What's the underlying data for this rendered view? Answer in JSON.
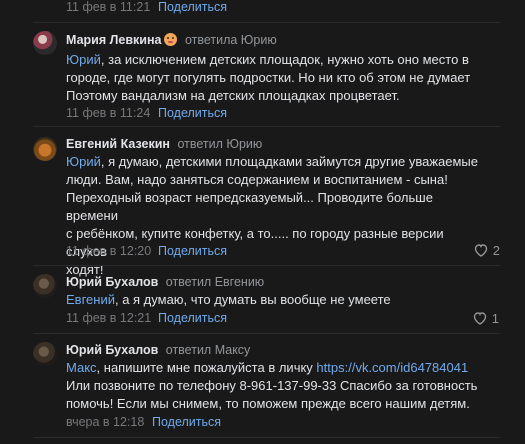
{
  "top_row": {
    "time": "11 фев в 11:21",
    "share": "Поделиться"
  },
  "comments": [
    {
      "author": "Мария Левкина",
      "replied": "ответила Юрию",
      "mention": "Юрий",
      "text_lines": [
        ", за исключением детских площадок, нужно хоть оно место в",
        "городе, где могут погулять подростки. Но ни кто об этом не думает",
        "Поэтому вандализм на детских площадках процветает."
      ],
      "time": "11 фев в 11:24",
      "share": "Поделиться",
      "likes": ""
    },
    {
      "author": "Евгений Казекин",
      "replied": "ответил Юрию",
      "mention": "Юрий",
      "text_lines": [
        ", я думаю, детскими площадками займутся другие уважаемые",
        "люди. Вам, надо заняться содержанием и воспитанием - сына!",
        "Переходный возраст непредсказуемый... Проводите больше времени",
        "с ребёнком, купите конфетку, а то..... по городу разные версии слухов",
        "ходят!"
      ],
      "time": "11 фев в 12:20",
      "share": "Поделиться",
      "likes": "2"
    },
    {
      "author": "Юрий Бухалов",
      "replied": "ответил Евгению",
      "mention": "Евгений",
      "text_lines": [
        ", а я думаю, что думать вы вообще не умеете"
      ],
      "time": "11 фев в 12:21",
      "share": "Поделиться",
      "likes": "1"
    },
    {
      "author": "Юрий Бухалов",
      "replied": "ответил Максу",
      "mention": "Макс",
      "text_first": ", напишите мне пожалуйста в личку ",
      "link": "https://vk.com/id64784041",
      "text_lines": [
        "Или позвоните по телефону 8-961-137-99-33 Спасибо за готовность",
        "помочь! Если мы снимем, то поможем прежде всего нашим детям."
      ],
      "time": "вчера в 12:18",
      "share": "Поделиться",
      "likes": ""
    }
  ],
  "colors": {
    "background": "#19191a",
    "accent": "#71aaeb",
    "muted": "#76787a",
    "text": "#e1e3e6"
  }
}
